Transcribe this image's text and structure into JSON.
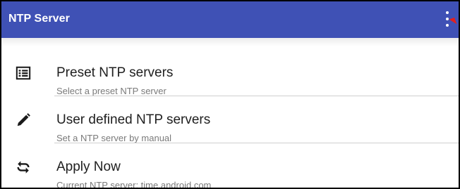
{
  "appbar": {
    "title": "NTP Server",
    "color": "#3f51b5",
    "overflow_icon": "more-vert-icon"
  },
  "items": [
    {
      "icon": "list-icon",
      "title": "Preset NTP servers",
      "subtitle": "Select a preset NTP server"
    },
    {
      "icon": "pencil-icon",
      "title": "User defined NTP servers",
      "subtitle": "Set a NTP server by manual"
    },
    {
      "icon": "sync-icon",
      "title": "Apply Now",
      "subtitle": "Current NTP server: time.android.com"
    }
  ]
}
